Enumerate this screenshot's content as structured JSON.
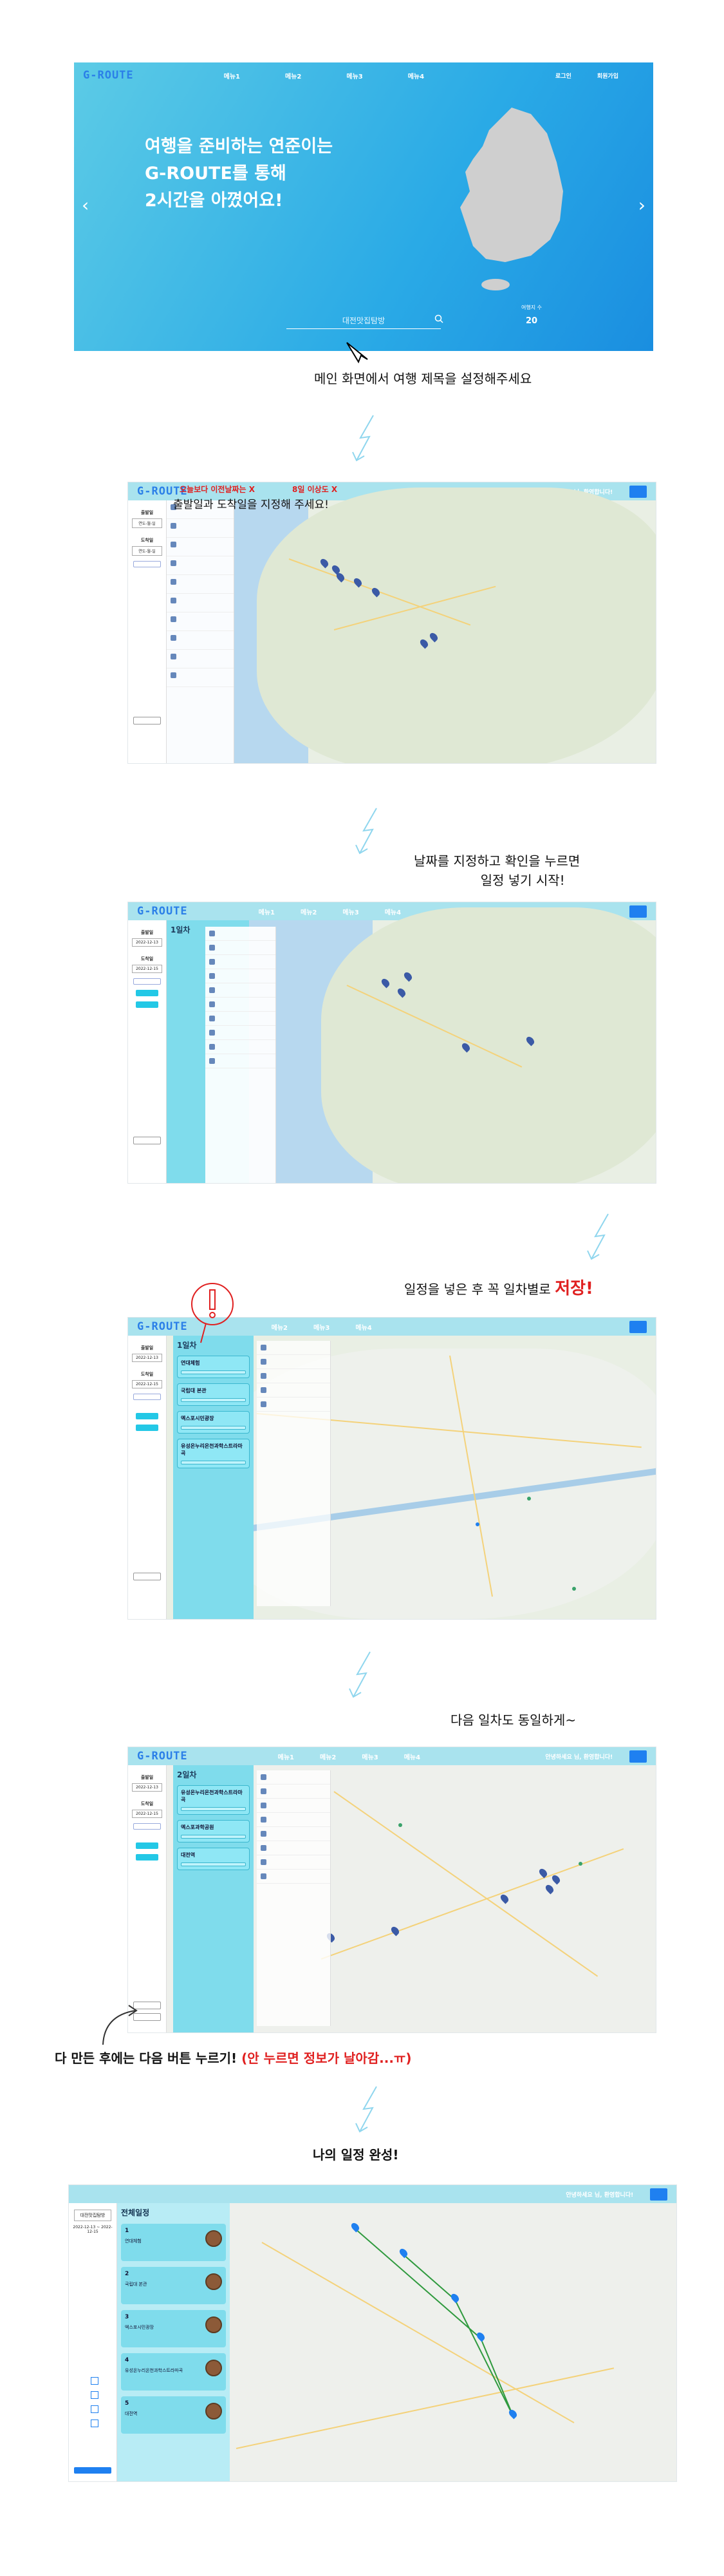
{
  "hero": {
    "logo": "G-ROUTE",
    "nav": [
      "메뉴1",
      "메뉴2",
      "메뉴3",
      "메뉴4"
    ],
    "nav_right": [
      "로그인",
      "회원가입"
    ],
    "copy_line1": "여행을 준비하는 연준이는",
    "copy_line2": "G-ROUTE를 통해",
    "copy_line3": "2시간을 아꼈어요!",
    "search_placeholder": "대전맛집탐방",
    "count_label": "여행지 수",
    "count_value": "20",
    "prev_icon": "chevron-left-icon",
    "next_icon": "chevron-right-icon"
  },
  "captions": {
    "c1": "메인 화면에서 여행 제목을 설정해주세요",
    "c3a": "날짜를 지정하고 확인을 누르면",
    "c3b": "일정 넣기 시작!",
    "c4a": "일정을 넣은 후 꼭 일차별로 ",
    "c4b": "저장!",
    "c5": "다음 일차도 동일하게~",
    "c6a": "다 만든 후에는 다음 버튼 누르기! ",
    "c6b": "(안 누르면 정보가 날아감...ㅠ)",
    "c7": "나의 일정 완성!"
  },
  "shot2": {
    "warn1": "오늘보다 이전날짜는 X",
    "warn2": "8일 이상도 X",
    "instruction": "출발일과 도착일을 지정해 주세요!",
    "start_label": "출발일",
    "end_label": "도착일",
    "start_date": "연도-월-일",
    "end_date": "연도-월-일",
    "user": "안녕하세요 님, 환영합니다!"
  },
  "shot3": {
    "day": "1일차",
    "start_date": "2022-12-13",
    "end_date": "2022-12-15"
  },
  "shot4": {
    "day": "1일차",
    "alert_icon": "exclamation-icon",
    "cards": [
      "연대체험",
      "국립대 본관",
      "엑스포시민광장",
      "유성온누리온천과학스트라마곡"
    ]
  },
  "shot5": {
    "day": "2일차",
    "cards": [
      "유성온누리온천과학스트라마곡",
      "엑스포과학공원",
      "대전역"
    ]
  },
  "shot7": {
    "title": "대전맛집탐방",
    "date": "2022-12-13 ~ 2022-12-15",
    "header": "전체일정",
    "stops": [
      {
        "no": "1",
        "name": "연대체험"
      },
      {
        "no": "2",
        "name": "국립대 본관"
      },
      {
        "no": "3",
        "name": "엑스포시민광장"
      },
      {
        "no": "4",
        "name": "유성온누리온천과학스트라마곡"
      },
      {
        "no": "5",
        "name": "대전역"
      }
    ]
  },
  "colors": {
    "accent": "#1f80f0",
    "cyan": "#7fdcec",
    "alert": "#e02020"
  }
}
